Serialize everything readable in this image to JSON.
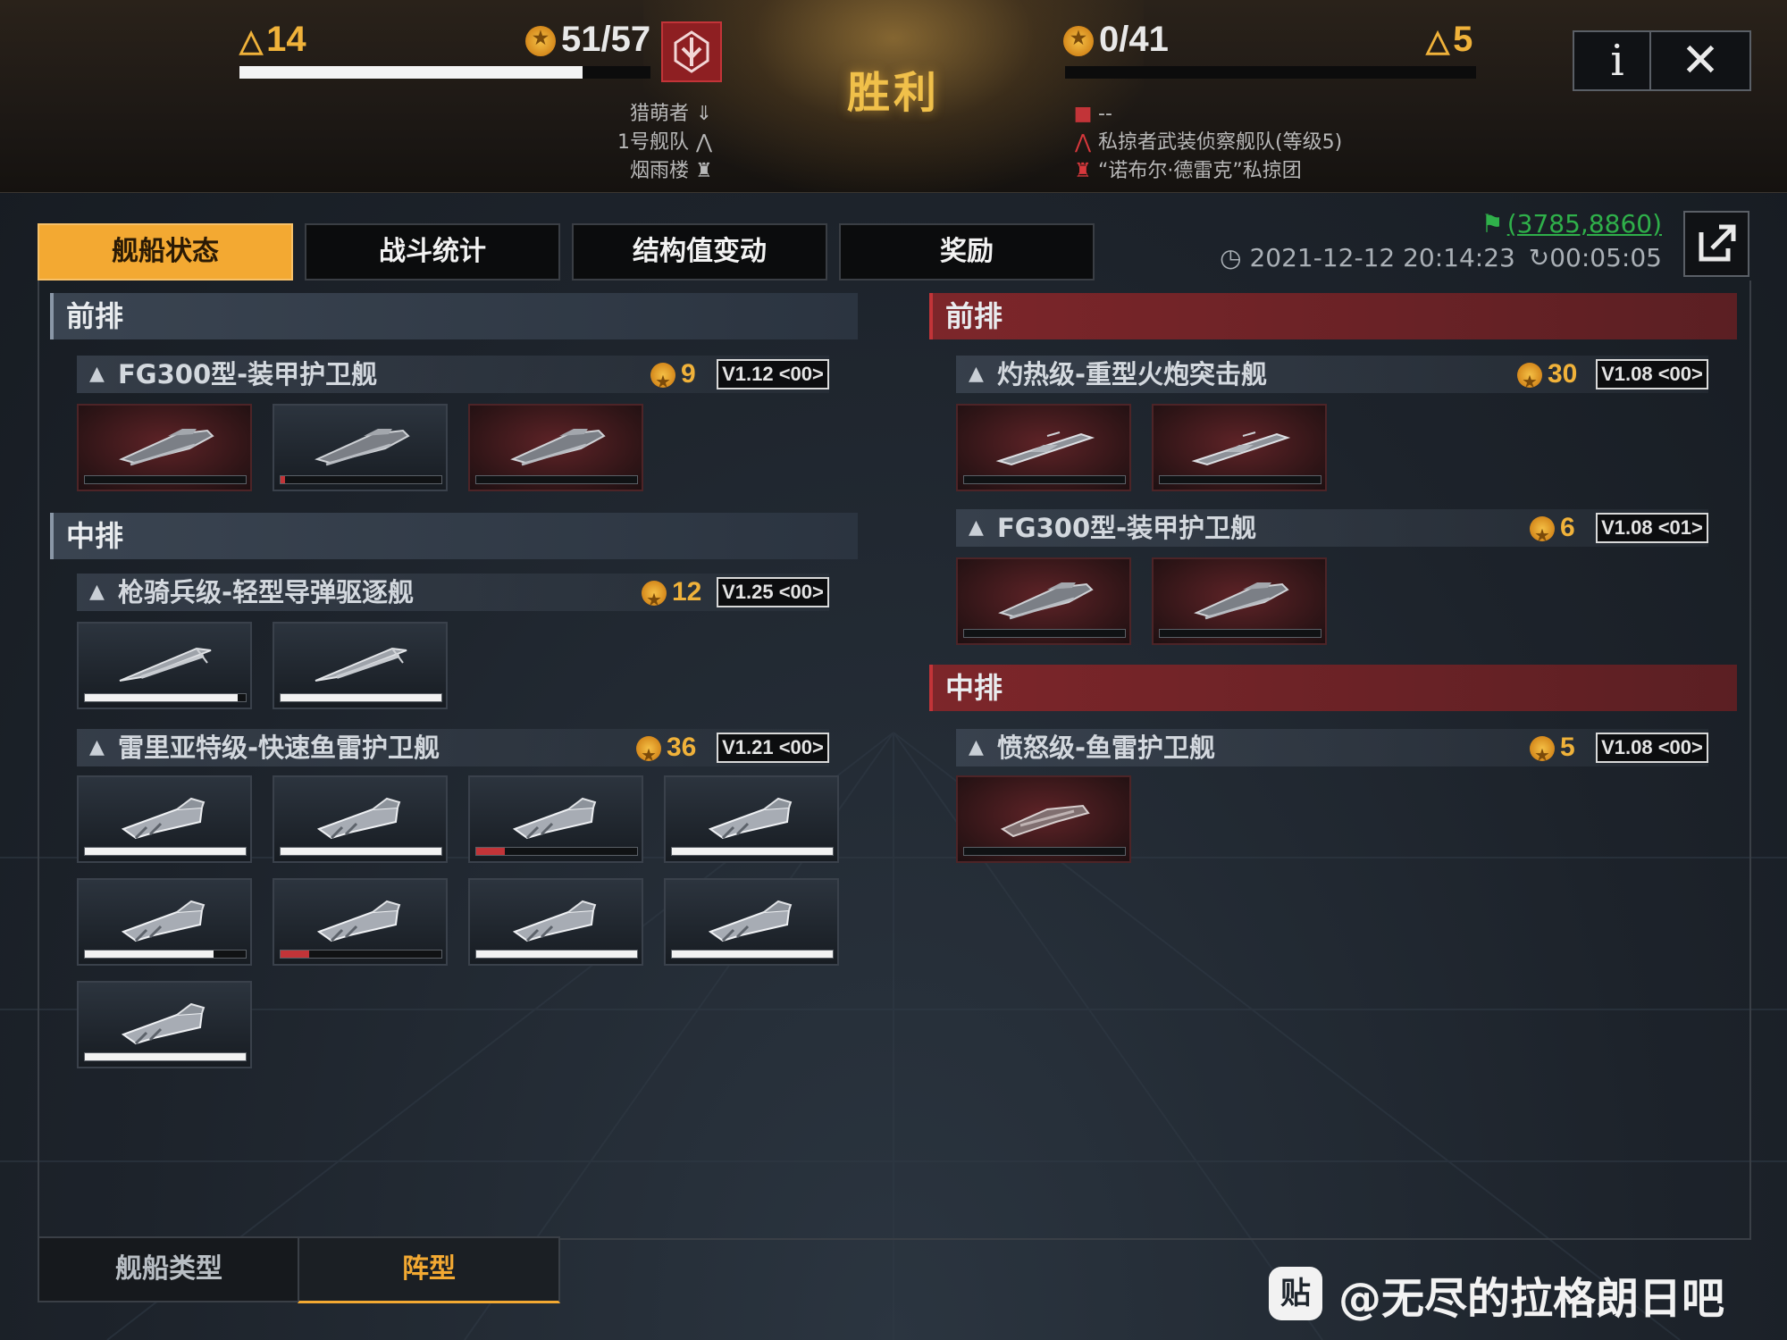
{
  "header": {
    "result": "胜利",
    "left": {
      "triangle_count": "14",
      "score": "51/57",
      "hp_fraction": 0.835
    },
    "right": {
      "score": "0/41",
      "triangle_count": "5",
      "hp_fraction": 0.0
    },
    "left_fleet": [
      "猎萌者",
      "1号舰队",
      "烟雨楼"
    ],
    "right_fleet": [
      "--",
      "私掠者武装侦察舰队(等级5)",
      "“诺布尔·德雷克”私掠团"
    ],
    "info_label": "i",
    "close_label": "✕"
  },
  "tabs": [
    "舰船状态",
    "战斗统计",
    "结构值变动",
    "奖励"
  ],
  "active_tab": 0,
  "meta": {
    "coordinates": "(3785,8860)",
    "datetime": "2021-12-12 20:14:23",
    "duration": "00:05:05"
  },
  "left_panel": {
    "rows": [
      {
        "title": "前排",
        "ships": [
          {
            "name": "FG300型-装甲护卫舰",
            "cost": "9",
            "version": "V1.12 <00>",
            "units": [
              {
                "hp": 0,
                "destroyed": true
              },
              {
                "hp": 0.03,
                "destroyed": false
              },
              {
                "hp": 0,
                "destroyed": true
              }
            ]
          }
        ]
      },
      {
        "title": "中排",
        "ships": [
          {
            "name": "枪骑兵级-轻型导弹驱逐舰",
            "cost": "12",
            "version": "V1.25 <00>",
            "units": [
              {
                "hp": 0.95
              },
              {
                "hp": 1.0
              }
            ]
          },
          {
            "name": "雷里亚特级-快速鱼雷护卫舰",
            "cost": "36",
            "version": "V1.21 <00>",
            "units": [
              {
                "hp": 1.0
              },
              {
                "hp": 1.0
              },
              {
                "hp": 0.18,
                "low": true
              },
              {
                "hp": 1.0
              },
              {
                "hp": 0.8
              },
              {
                "hp": 0.18,
                "low": true
              },
              {
                "hp": 1.0
              },
              {
                "hp": 1.0
              },
              {
                "hp": 1.0
              }
            ]
          }
        ]
      }
    ]
  },
  "right_panel": {
    "rows": [
      {
        "title": "前排",
        "ships": [
          {
            "name": "灼热级-重型火炮突击舰",
            "cost": "30",
            "version": "V1.08 <00>",
            "units": [
              {
                "hp": 0,
                "destroyed": true
              },
              {
                "hp": 0,
                "destroyed": true
              }
            ]
          },
          {
            "name": "FG300型-装甲护卫舰",
            "cost": "6",
            "version": "V1.08 <01>",
            "units": [
              {
                "hp": 0,
                "destroyed": true
              },
              {
                "hp": 0,
                "destroyed": true
              }
            ]
          }
        ]
      },
      {
        "title": "中排",
        "ships": [
          {
            "name": "愤怒级-鱼雷护卫舰",
            "cost": "5",
            "version": "V1.08 <00>",
            "units": [
              {
                "hp": 0,
                "destroyed": true
              }
            ]
          }
        ]
      }
    ]
  },
  "bottom_tabs": [
    "舰船类型",
    "阵型"
  ],
  "bottom_active": 1,
  "watermark": {
    "icon": "贴",
    "text": "@无尽的拉格朗日吧"
  },
  "colors": {
    "accent": "#f3a932",
    "enemy": "#c23438",
    "coords": "#2fb04a"
  }
}
